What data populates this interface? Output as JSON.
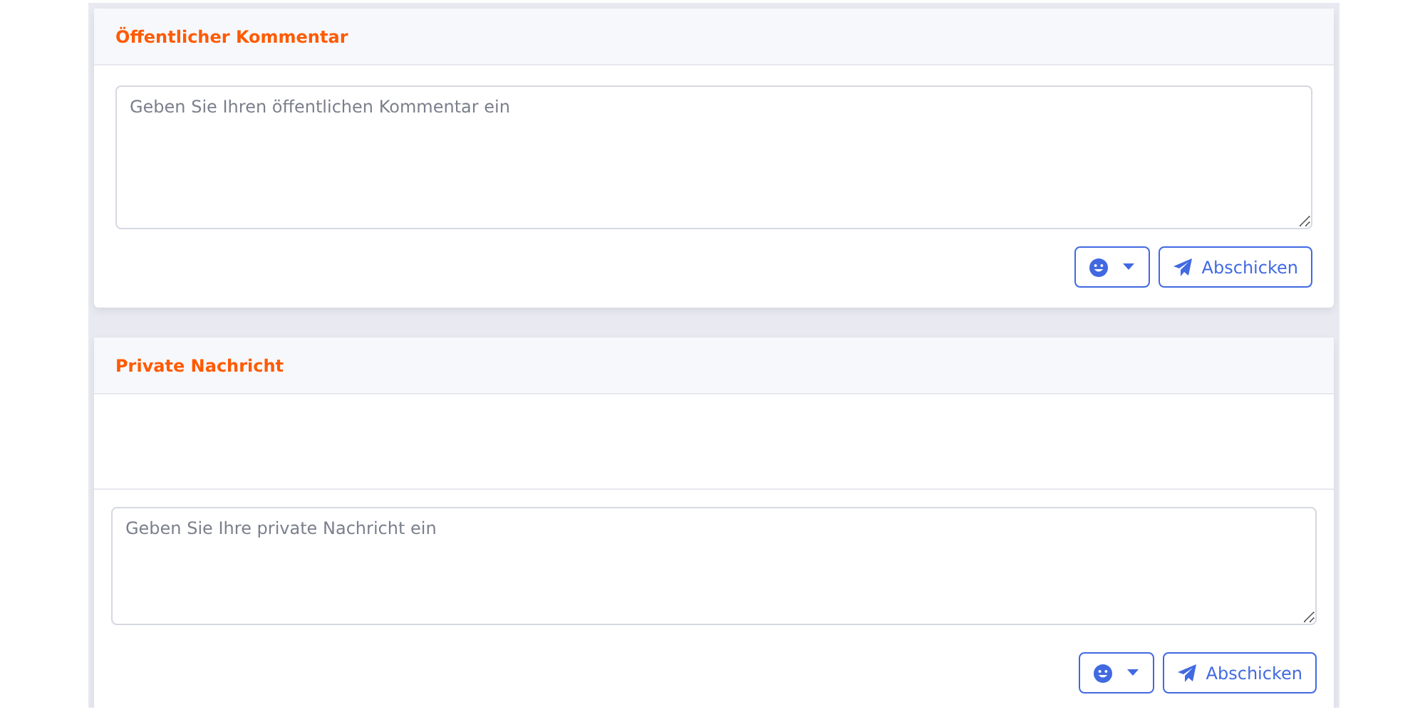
{
  "cards": [
    {
      "kind": "comment",
      "title": "Öffentlicher Kommentar",
      "placeholder": "Geben Sie Ihren öffentlichen Kommentar ein",
      "send_label": "Abschicken"
    },
    {
      "kind": "chat",
      "title": "Private Nachricht",
      "placeholder": "Geben Sie Ihre private Nachricht ein",
      "send_label": "Abschicken"
    }
  ]
}
